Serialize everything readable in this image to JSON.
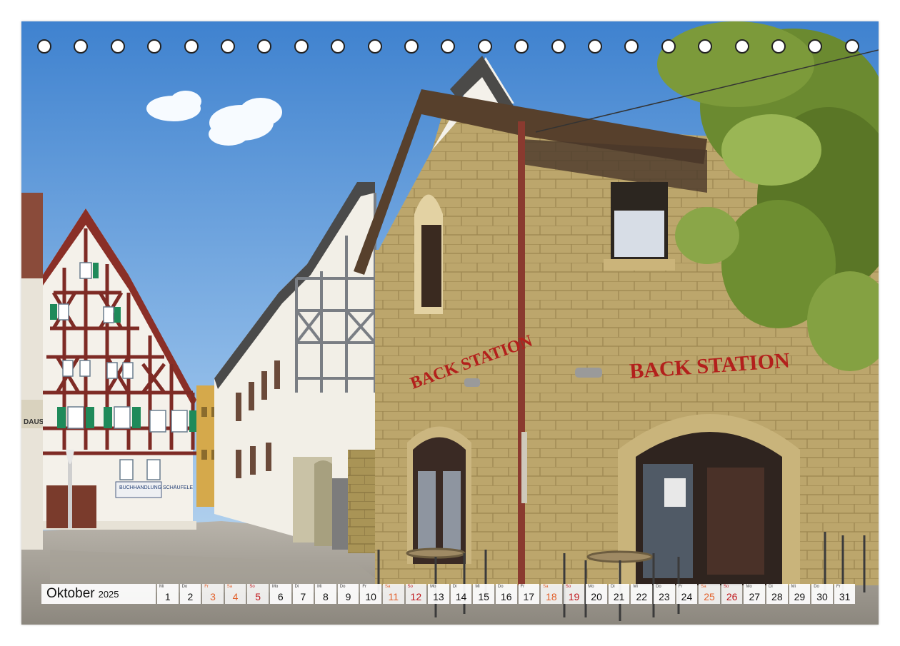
{
  "calendar": {
    "month": "Oktober",
    "year": "2025",
    "days": [
      {
        "wd": "Mi",
        "num": "1",
        "type": "weekday"
      },
      {
        "wd": "Do",
        "num": "2",
        "type": "weekday"
      },
      {
        "wd": "Fr",
        "num": "3",
        "type": "holiday"
      },
      {
        "wd": "Sa",
        "num": "4",
        "type": "sat"
      },
      {
        "wd": "So",
        "num": "5",
        "type": "sun"
      },
      {
        "wd": "Mo",
        "num": "6",
        "type": "weekday"
      },
      {
        "wd": "Di",
        "num": "7",
        "type": "weekday"
      },
      {
        "wd": "Mi",
        "num": "8",
        "type": "weekday"
      },
      {
        "wd": "Do",
        "num": "9",
        "type": "weekday"
      },
      {
        "wd": "Fr",
        "num": "10",
        "type": "weekday"
      },
      {
        "wd": "Sa",
        "num": "11",
        "type": "sat"
      },
      {
        "wd": "So",
        "num": "12",
        "type": "sun"
      },
      {
        "wd": "Mo",
        "num": "13",
        "type": "weekday"
      },
      {
        "wd": "Di",
        "num": "14",
        "type": "weekday"
      },
      {
        "wd": "Mi",
        "num": "15",
        "type": "weekday"
      },
      {
        "wd": "Do",
        "num": "16",
        "type": "weekday"
      },
      {
        "wd": "Fr",
        "num": "17",
        "type": "weekday"
      },
      {
        "wd": "Sa",
        "num": "18",
        "type": "sat"
      },
      {
        "wd": "So",
        "num": "19",
        "type": "sun"
      },
      {
        "wd": "Mo",
        "num": "20",
        "type": "weekday"
      },
      {
        "wd": "Di",
        "num": "21",
        "type": "weekday"
      },
      {
        "wd": "Mi",
        "num": "22",
        "type": "weekday"
      },
      {
        "wd": "Do",
        "num": "23",
        "type": "weekday"
      },
      {
        "wd": "Fr",
        "num": "24",
        "type": "weekday"
      },
      {
        "wd": "Sa",
        "num": "25",
        "type": "sat"
      },
      {
        "wd": "So",
        "num": "26",
        "type": "sun"
      },
      {
        "wd": "Mo",
        "num": "27",
        "type": "weekday"
      },
      {
        "wd": "Di",
        "num": "28",
        "type": "weekday"
      },
      {
        "wd": "Mi",
        "num": "29",
        "type": "weekday"
      },
      {
        "wd": "Do",
        "num": "30",
        "type": "weekday"
      },
      {
        "wd": "Fr",
        "num": "31",
        "type": "weekday"
      }
    ]
  },
  "photo": {
    "shop_sign_main": "BACK STATION",
    "shop_sign_side": "BACK STATION",
    "bookshop_sign": "BUCHHANDLUNG SCHÄUFELE",
    "left_sign": "DAUSCH"
  },
  "colors": {
    "saturday": "#e2602a",
    "sunday": "#c0161b",
    "sign_red": "#b3201c",
    "sky": "#6fa8de",
    "sandstone": "#bba46a"
  },
  "holes_count": 23
}
